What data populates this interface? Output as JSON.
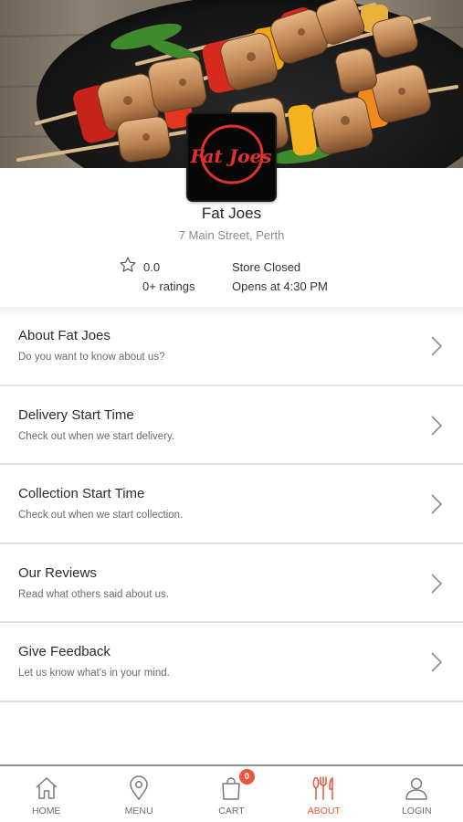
{
  "store": {
    "name": "Fat Joes",
    "address": "7 Main Street, Perth",
    "rating": "0.0",
    "ratings_count": "0+ ratings",
    "status": "Store Closed",
    "opens_at": "Opens at 4:30 PM",
    "logo_text": "Fat Joes"
  },
  "menu": {
    "items": [
      {
        "title": "About Fat Joes",
        "subtitle": "Do you want to know about us?"
      },
      {
        "title": "Delivery Start Time",
        "subtitle": "Check out when we start delivery."
      },
      {
        "title": "Collection Start Time",
        "subtitle": "Check out when we start collection."
      },
      {
        "title": "Our Reviews",
        "subtitle": "Read what others said about us."
      },
      {
        "title": "Give Feedback",
        "subtitle": "Let us know what's in your mind."
      }
    ]
  },
  "bottom_nav": {
    "items": [
      {
        "label": "HOME",
        "icon": "home-icon",
        "active": false
      },
      {
        "label": "MENU",
        "icon": "location-pin-icon",
        "active": false
      },
      {
        "label": "CART",
        "icon": "shopping-bag-icon",
        "active": false
      },
      {
        "label": "ABOUT",
        "icon": "cutlery-icon",
        "active": true
      },
      {
        "label": "LOGIN",
        "icon": "user-icon",
        "active": false
      }
    ],
    "cart_count": "0"
  },
  "colors": {
    "accent": "#e8573a",
    "logo_background": "#070707",
    "logo_text": "#e0322c"
  }
}
